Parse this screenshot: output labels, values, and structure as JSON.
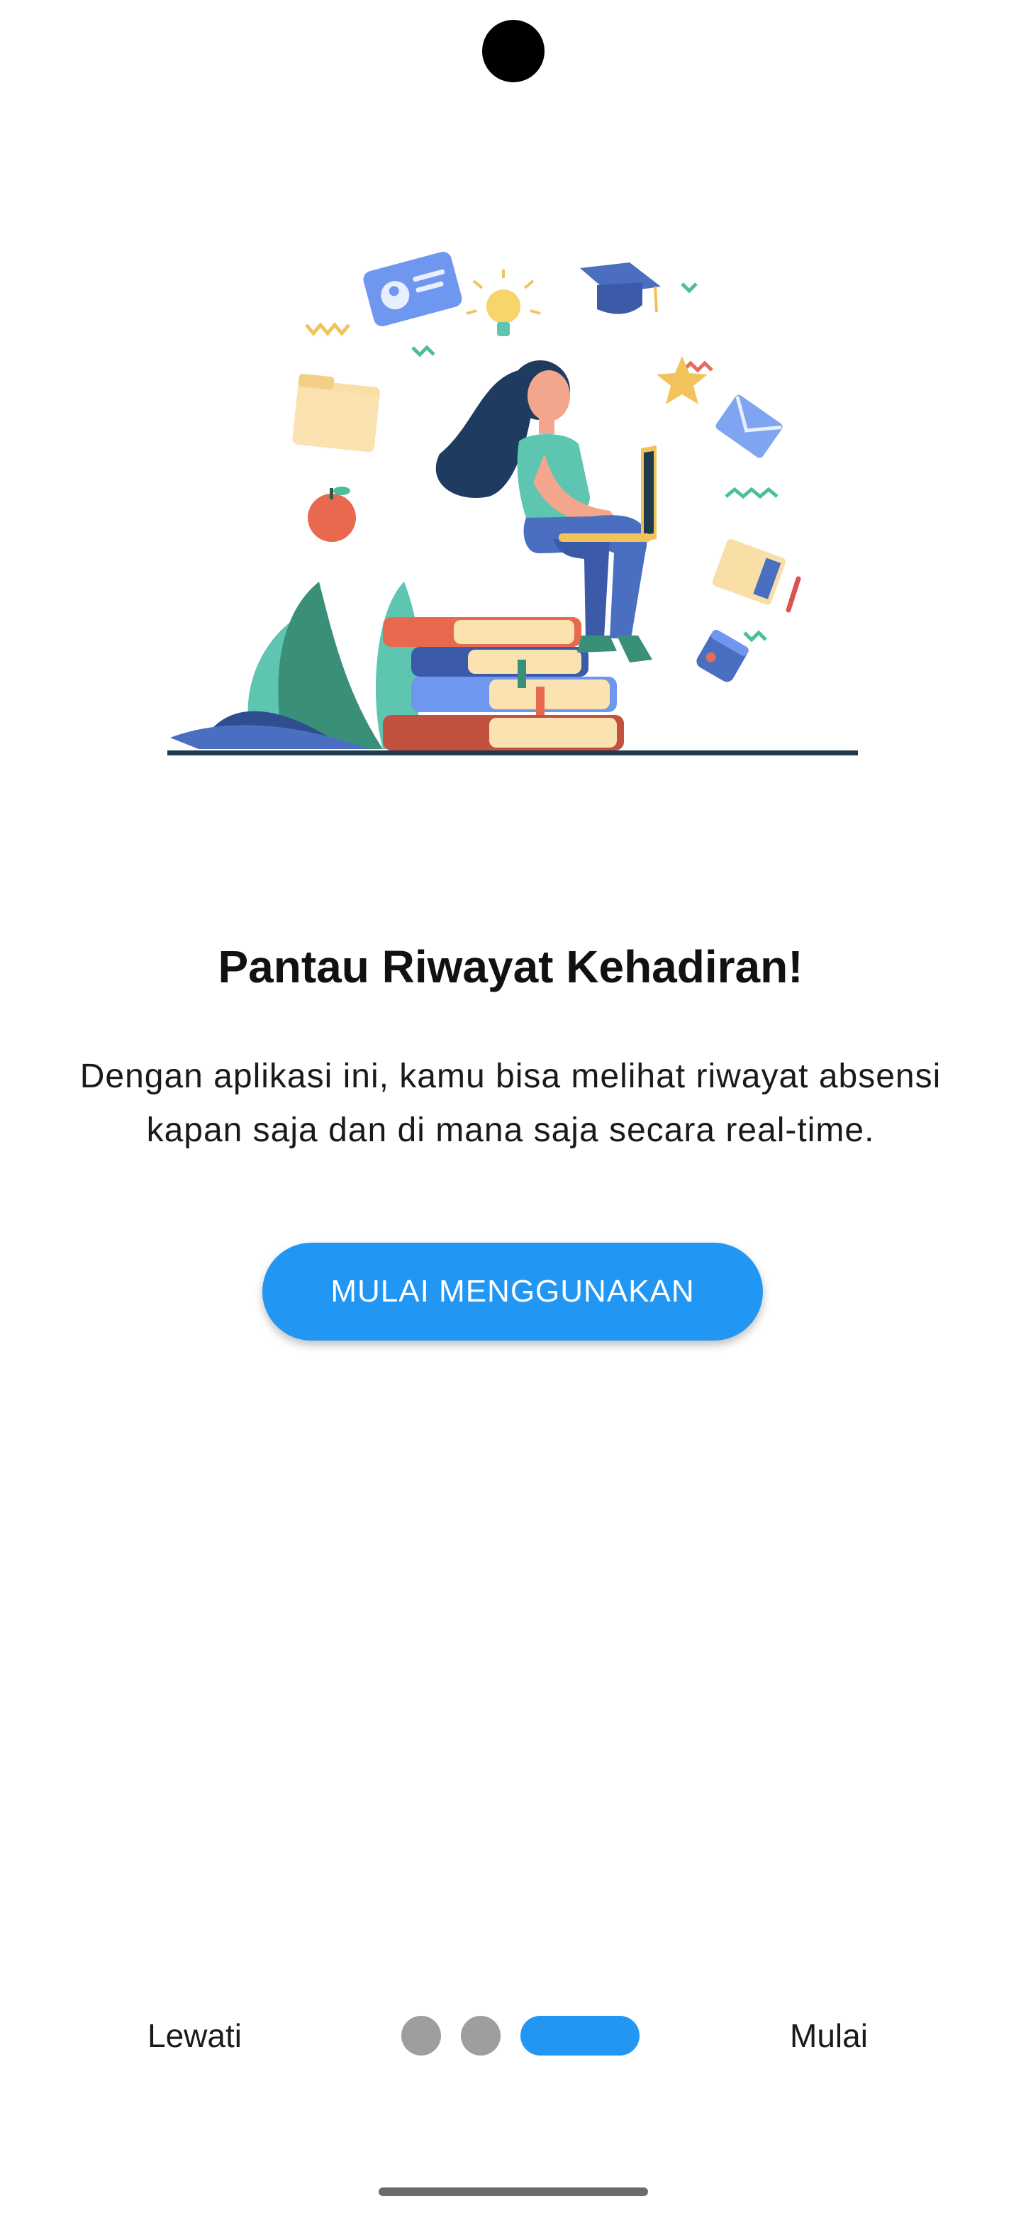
{
  "onboarding": {
    "illustration": "student-studying-laptop-illustration",
    "title": "Pantau Riwayat Kehadiran!",
    "description": "Dengan aplikasi ini, kamu bisa melihat riwayat absensi kapan saja dan di mana saja secara real-time.",
    "cta_label": "MULAI MENGGUNAKAN"
  },
  "bottom_nav": {
    "skip_label": "Lewati",
    "start_label": "Mulai",
    "page_count": 3,
    "current_page": 3
  },
  "colors": {
    "accent": "#2196F3",
    "inactive_dot": "#9E9E9E",
    "text": "#111111"
  }
}
